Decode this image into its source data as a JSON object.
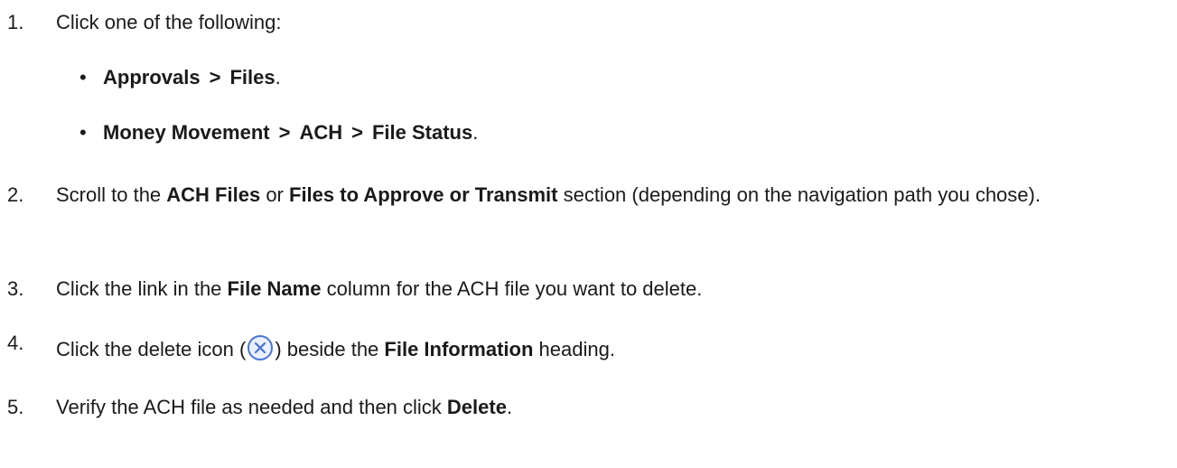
{
  "steps": {
    "s1": {
      "num": "1.",
      "text": "Click one of the following:"
    },
    "bullets": [
      {
        "parts": [
          "Approvals",
          "Files"
        ],
        "end": "."
      },
      {
        "parts": [
          "Money Movement",
          "ACH",
          "File Status"
        ],
        "end": "."
      }
    ],
    "separator": ">",
    "bullet_glyph": "•",
    "s2": {
      "num": "2.",
      "pre": "Scroll to the ",
      "b1": "ACH Files",
      "mid": " or ",
      "b2": "Files to Approve or Transmit",
      "post": " section (depending on the navigation path you chose)."
    },
    "s3": {
      "num": "3.",
      "pre": "Click the link in the ",
      "b1": "File Name",
      "post": " column for the ACH file you want to delete."
    },
    "s4": {
      "num": "4.",
      "pre": "Click the delete icon (",
      "icon": "close-circle-icon",
      "mid": ") beside the ",
      "b1": "File Information",
      "post": " heading."
    },
    "s5": {
      "num": "5.",
      "pre": "Verify the ACH file as needed and then click ",
      "b1": "Delete",
      "post": "."
    }
  },
  "colors": {
    "text": "#1a1a1a",
    "icon_stroke": "#4a74d8",
    "icon_fill": "#eaf0fd"
  }
}
